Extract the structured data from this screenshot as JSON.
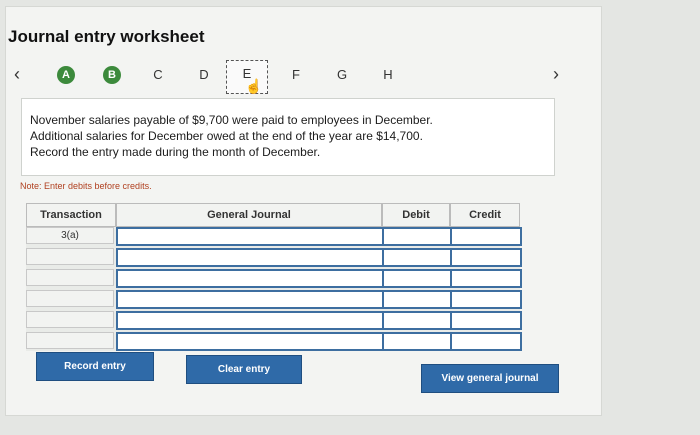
{
  "page_title": "Journal entry worksheet",
  "nav": {
    "prev_icon": "chevron-left-icon",
    "next_icon": "chevron-right-icon",
    "steps": [
      {
        "label": "A",
        "state": "done"
      },
      {
        "label": "B",
        "state": "done"
      },
      {
        "label": "C",
        "state": "pending"
      },
      {
        "label": "D",
        "state": "pending"
      },
      {
        "label": "E",
        "state": "current"
      },
      {
        "label": "F",
        "state": "pending"
      },
      {
        "label": "G",
        "state": "pending"
      },
      {
        "label": "H",
        "state": "pending"
      }
    ]
  },
  "problem": {
    "line1": "November salaries payable of $9,700 were paid to employees in December.",
    "line2": "Additional salaries for December owed at the end of the year are $14,700.",
    "line3": "Record the entry made during the month of December."
  },
  "note": "Note: Enter debits before credits.",
  "table": {
    "headers": {
      "transaction": "Transaction",
      "general_journal": "General Journal",
      "debit": "Debit",
      "credit": "Credit"
    },
    "rows": [
      {
        "transaction": "3(a)",
        "account": "",
        "debit": "",
        "credit": ""
      },
      {
        "transaction": "",
        "account": "",
        "debit": "",
        "credit": ""
      },
      {
        "transaction": "",
        "account": "",
        "debit": "",
        "credit": ""
      },
      {
        "transaction": "",
        "account": "",
        "debit": "",
        "credit": ""
      },
      {
        "transaction": "",
        "account": "",
        "debit": "",
        "credit": ""
      },
      {
        "transaction": "",
        "account": "",
        "debit": "",
        "credit": ""
      }
    ]
  },
  "buttons": {
    "record": "Record entry",
    "clear": "Clear entry",
    "view": "View general journal"
  },
  "colors": {
    "step_done": "#3c8a3c",
    "button": "#2f6aa8",
    "cell_border": "#3d6ea0"
  }
}
